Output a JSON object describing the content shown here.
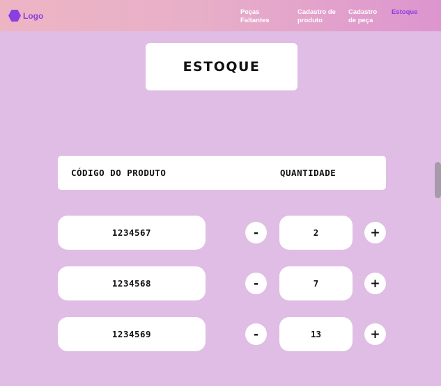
{
  "nav": {
    "logo_label": "Logo",
    "links": [
      {
        "label": "Peças\nFaltantes"
      },
      {
        "label": "Cadastro de\nproduto"
      },
      {
        "label": "Cadastro\nde peça"
      },
      {
        "label": "Estoque"
      }
    ]
  },
  "main": {
    "title": "ESTOQUE",
    "headers": {
      "code": "CÓDIGO DO PRODUTO",
      "quantity": "QUANTIDADE"
    },
    "rows": [
      {
        "code": "1234567",
        "quantity": "2"
      },
      {
        "code": "1234568",
        "quantity": "7"
      },
      {
        "code": "1234569",
        "quantity": "13"
      }
    ],
    "minus_label": "-",
    "plus_label": "+"
  },
  "colors": {
    "background": "#e0bde5",
    "accent": "#8a3fe0",
    "navbar_start": "#edb5c4",
    "navbar_end": "#dd95cf"
  },
  "icons": {
    "logo": "hexagon-icon"
  }
}
